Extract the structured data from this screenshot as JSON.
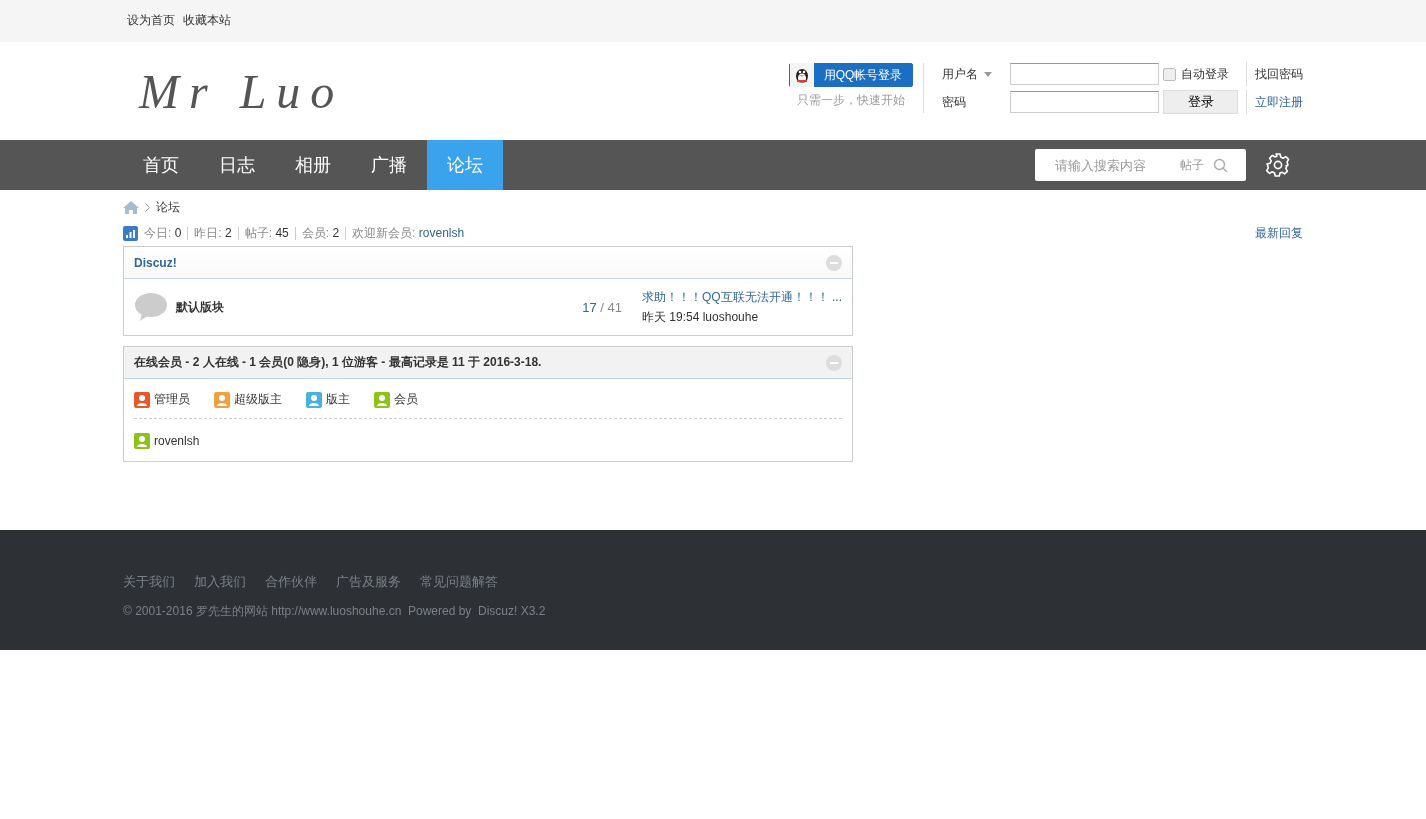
{
  "topbar": {
    "links": [
      "设为首页",
      "收藏本站"
    ]
  },
  "header": {
    "logo": "Mr Luo",
    "qq_login": {
      "button": "用QQ帐号登录",
      "hint": "只需一步，快速开始"
    },
    "login": {
      "username_label": "用户名",
      "password_label": "密码",
      "auto_login": {
        "label": "自动登录",
        "checked": false
      },
      "submit": "登录",
      "forgot": "找回密码",
      "register": "立即注册"
    }
  },
  "nav": {
    "items": [
      {
        "label": "首页",
        "selected": false
      },
      {
        "label": "日志",
        "selected": false
      },
      {
        "label": "相册",
        "selected": false
      },
      {
        "label": "广播",
        "selected": false
      },
      {
        "label": "论坛",
        "selected": true
      }
    ],
    "search": {
      "placeholder": "请输入搜索内容",
      "scope": "帖子"
    }
  },
  "breadcrumb": [
    "论坛"
  ],
  "stats": {
    "items": [
      {
        "label": "今日:",
        "value": "0"
      },
      {
        "label": "昨日:",
        "value": "2"
      },
      {
        "label": "帖子:",
        "value": "45"
      },
      {
        "label": "会员:",
        "value": "2"
      }
    ],
    "welcome_label": "欢迎新会员:",
    "welcome_user": "rovenlsh",
    "latest_link": "最新回复"
  },
  "category": {
    "title": "Discuz!",
    "forums": [
      {
        "name": "默认版块",
        "threads": "17",
        "count_separator": "/",
        "posts": "41",
        "last_title": "求助！！！QQ互联无法开通！！！ ...",
        "last_time": "昨天 19:54",
        "last_user": "luoshouhe"
      }
    ]
  },
  "online": {
    "title": "在线会员 - 2 人在线 - 1 会员(0 隐身), 1 位游客 - 最高记录是 11 于 2016-3-18.",
    "legend": [
      {
        "label": "管理员",
        "color": "#e8572a"
      },
      {
        "label": "超级版主",
        "color": "#f0a040"
      },
      {
        "label": "版主",
        "color": "#4ab0e0"
      },
      {
        "label": "会员",
        "color": "#8cc21a"
      }
    ],
    "users": [
      {
        "name": "rovenlsh",
        "color": "#8cc21a"
      }
    ]
  },
  "footer": {
    "links": [
      "关于我们",
      "加入我们",
      "合作伙伴",
      "广告及服务",
      "常见问题解答"
    ],
    "copyright": "© 2001-2016 罗先生的网站 http://www.luoshouhe.cn  Powered by  Discuz! X3.2"
  }
}
